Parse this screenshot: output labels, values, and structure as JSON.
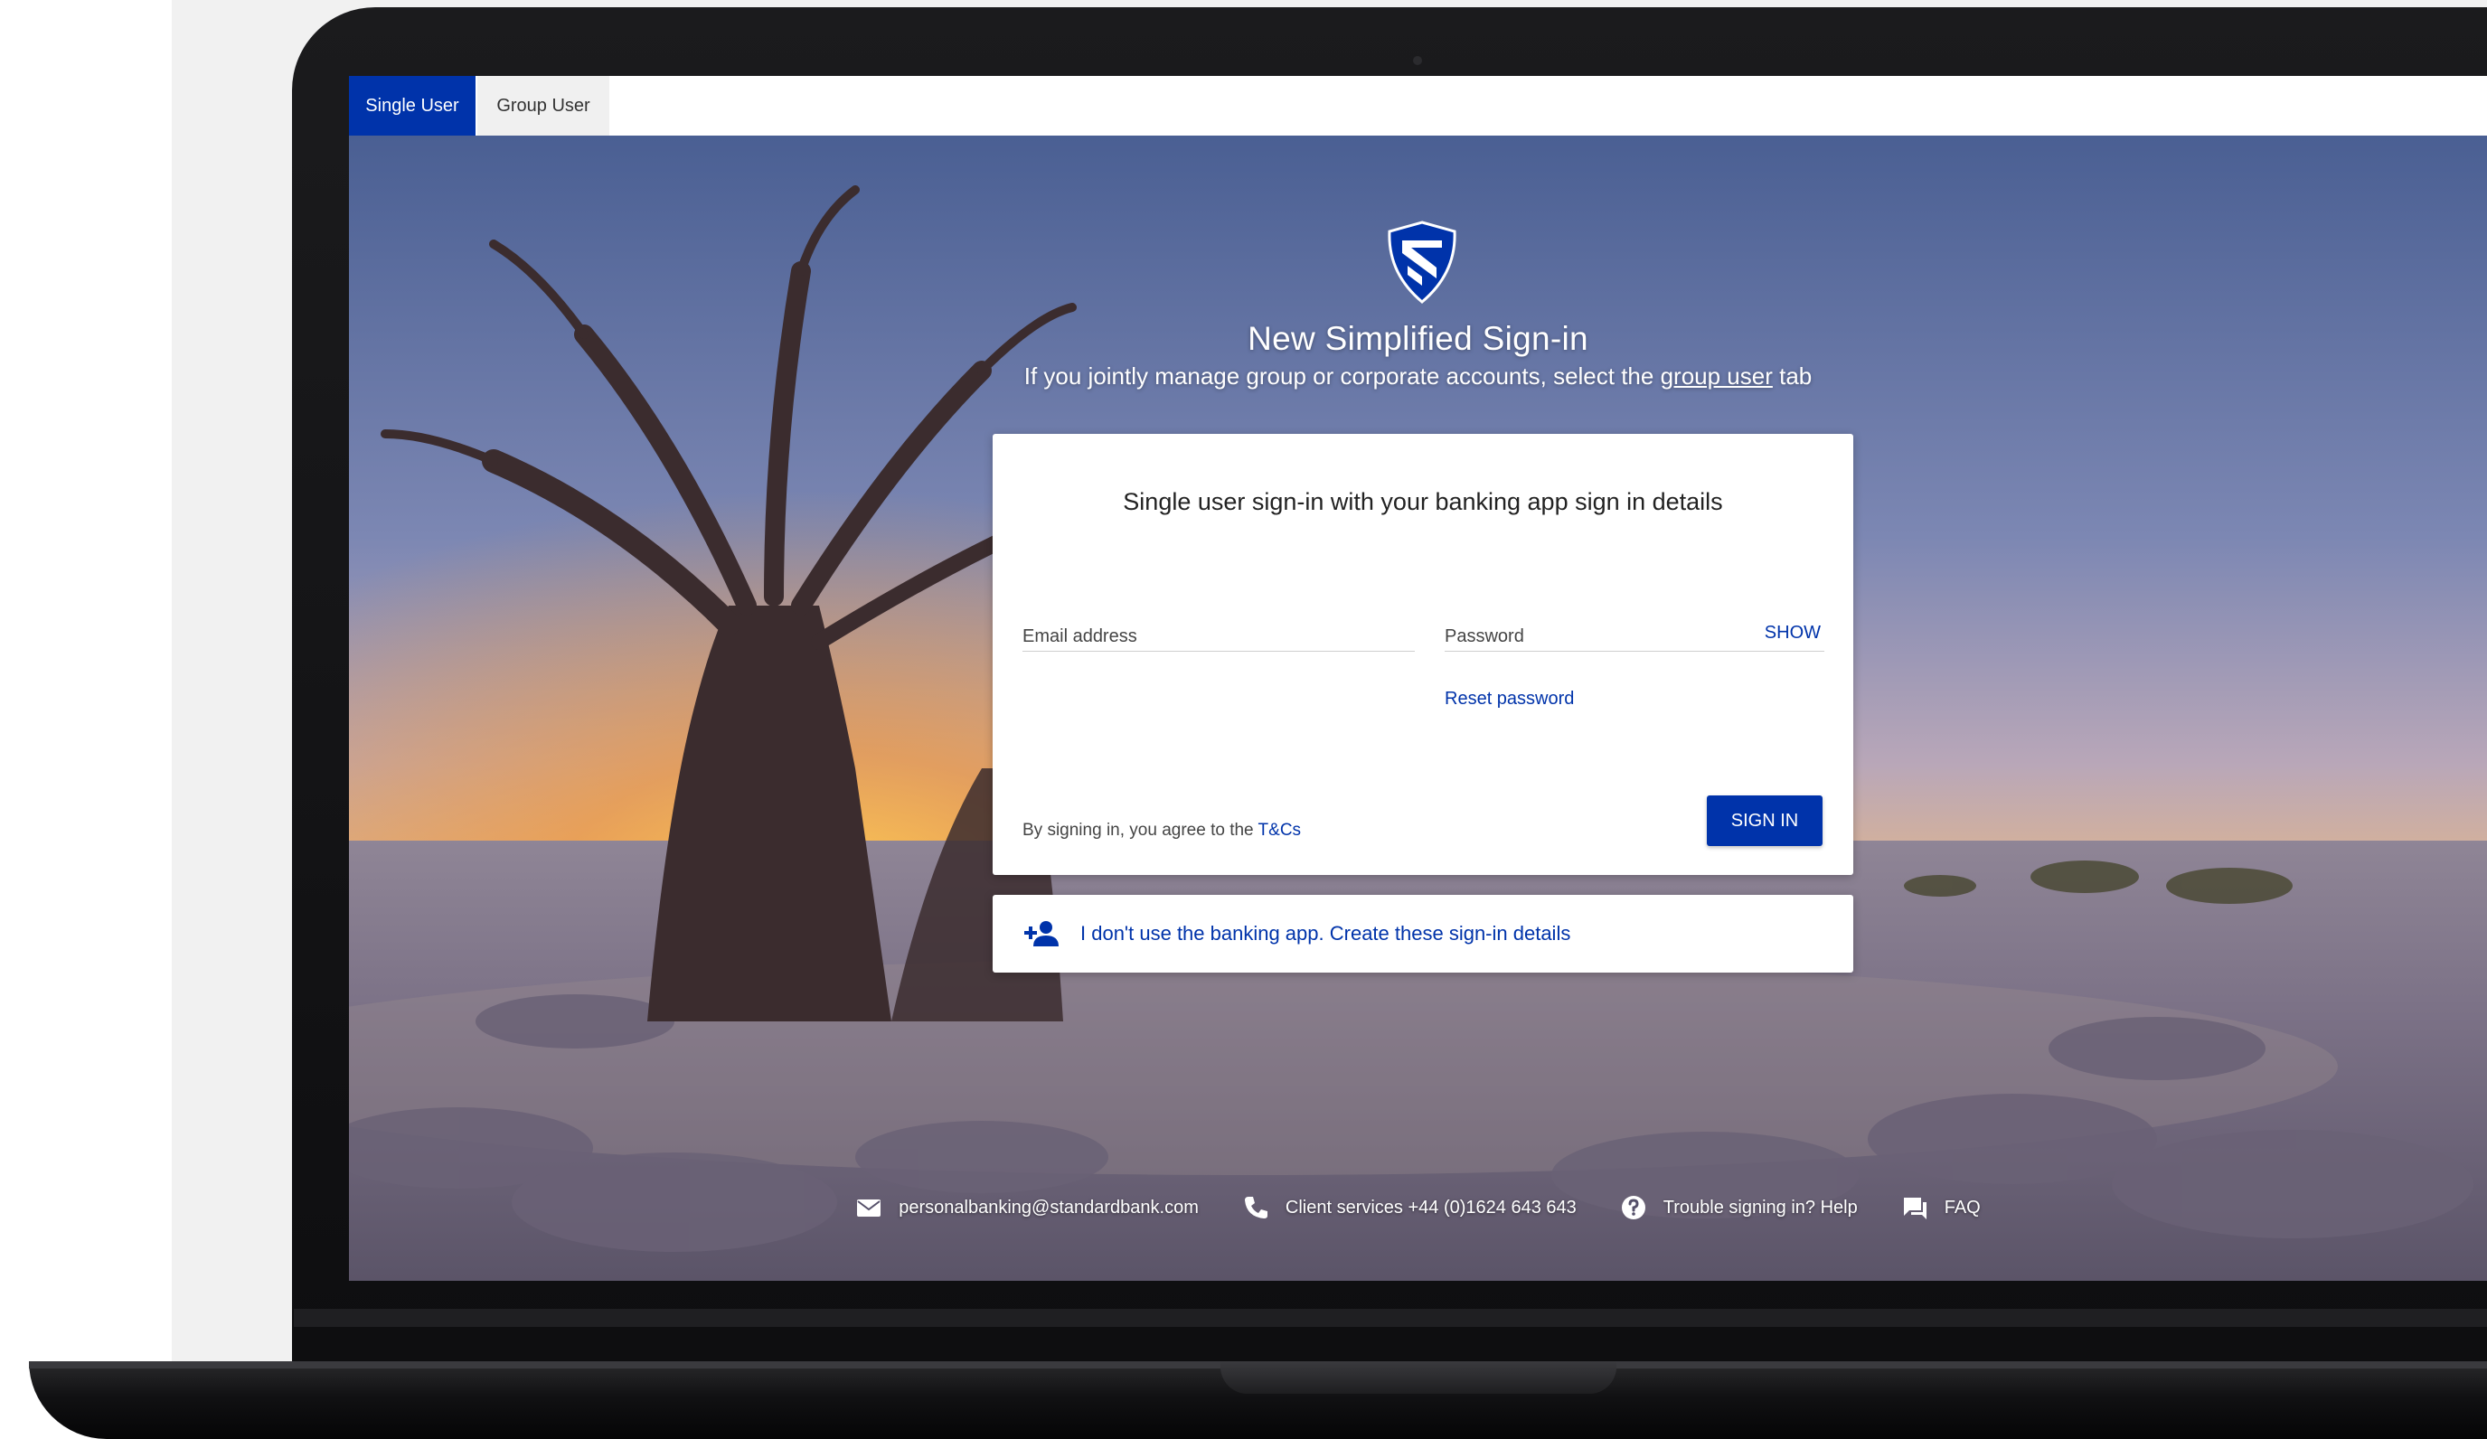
{
  "tabs": {
    "single_user": "Single User",
    "group_user": "Group User"
  },
  "hero": {
    "title": "New Simplified Sign-in",
    "subtitle_before": "If you jointly manage group or corporate accounts, select the ",
    "subtitle_link": "group user",
    "subtitle_after": " tab"
  },
  "signin_card": {
    "title": "Single user sign-in with your banking app sign in details",
    "email_placeholder": "Email address",
    "password_placeholder": "Password",
    "show_label": "SHOW",
    "reset_label": "Reset password",
    "terms_prefix": "By signing in, you agree to the ",
    "terms_link": "T&Cs",
    "signin_label": "SIGN IN"
  },
  "create_card": {
    "text": "I don't use the banking app. Create these sign-in details"
  },
  "footer": {
    "email": "personalbanking@standardbank.com",
    "phone": "Client services +44 (0)1624 643 643",
    "help": "Trouble signing in? Help",
    "faq": "FAQ"
  },
  "icons": {
    "logo": "shield-logo",
    "create": "add-user-icon",
    "email": "mail-icon",
    "phone": "phone-icon",
    "help": "help-circle-icon",
    "faq": "chat-icon"
  },
  "colors": {
    "brand_blue": "#0033aa",
    "tab_inactive_bg": "#f0f0f0",
    "white": "#ffffff"
  }
}
